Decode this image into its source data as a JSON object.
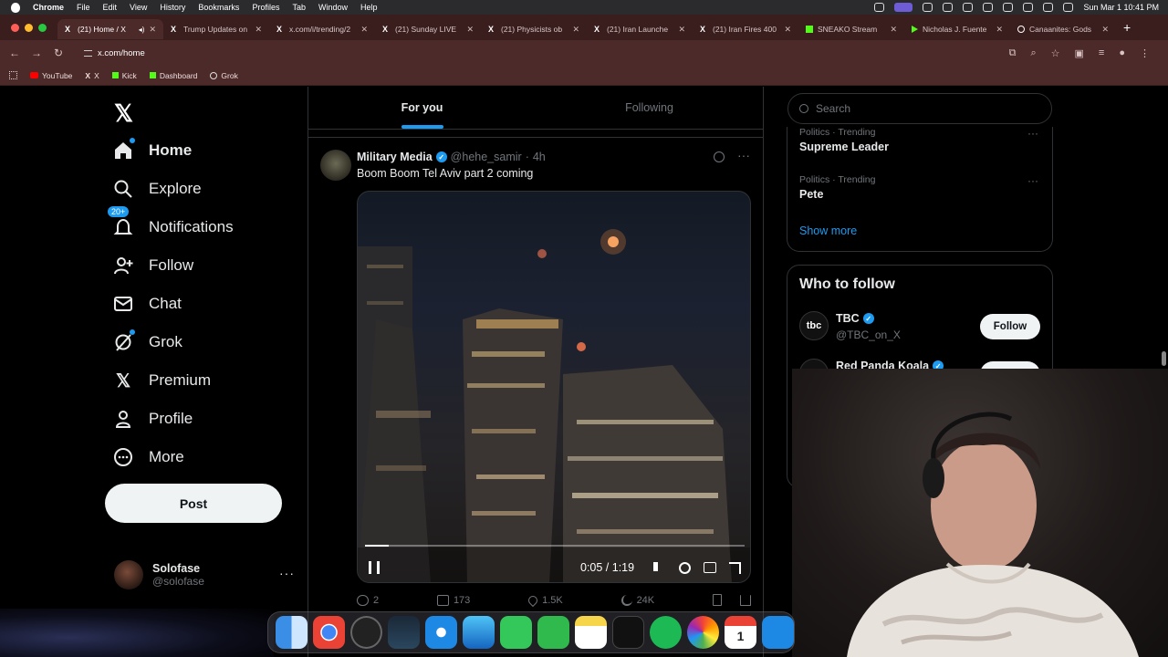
{
  "menubar": {
    "app": "Chrome",
    "items": [
      "File",
      "Edit",
      "View",
      "History",
      "Bookmarks",
      "Profiles",
      "Tab",
      "Window",
      "Help"
    ],
    "datetime": "Sun Mar 1  10:41 PM"
  },
  "tabs": [
    {
      "title": "(21) Home / X",
      "fav": "x"
    },
    {
      "title": "Trump Updates on",
      "fav": "x"
    },
    {
      "title": "x.com/i/trending/2",
      "fav": "x"
    },
    {
      "title": "(21) Sunday LIVE",
      "fav": "x"
    },
    {
      "title": "(21) Physicists ob",
      "fav": "x"
    },
    {
      "title": "(21) Iran Launche",
      "fav": "x"
    },
    {
      "title": "(21) Iran Fires 400",
      "fav": "x"
    },
    {
      "title": "SNEAKO Stream",
      "fav": "k"
    },
    {
      "title": "Nicholas J. Fuente",
      "fav": "p"
    },
    {
      "title": "Canaanites: Gods",
      "fav": "c"
    }
  ],
  "address": {
    "url": "x.com/home"
  },
  "bookmarks": [
    "YouTube",
    "X",
    "Kick",
    "Dashboard",
    "Grok"
  ],
  "nav": {
    "home": "Home",
    "explore": "Explore",
    "notifications": "Notifications",
    "notif_badge": "20+",
    "follow": "Follow",
    "chat": "Chat",
    "grok": "Grok",
    "premium": "Premium",
    "profile": "Profile",
    "more": "More",
    "post": "Post"
  },
  "account": {
    "name": "Solofase",
    "handle": "@solofase"
  },
  "feed": {
    "tab_for_you": "For you",
    "tab_following": "Following"
  },
  "tweet": {
    "name": "Military Media",
    "handle": "@hehe_samir",
    "time": "4h",
    "text": "Boom Boom Tel Aviv part 2 coming",
    "video_time": "0:05 / 1:19",
    "progress": 0.063,
    "replies": "2",
    "reposts": "173",
    "likes": "1.5K",
    "views": "24K"
  },
  "sidebar": {
    "search_placeholder": "Search",
    "trends": [
      {
        "category": "Politics · Trending",
        "name": "Supreme Leader"
      },
      {
        "category": "Politics · Trending",
        "name": "Pete"
      }
    ],
    "show_more": "Show more",
    "who_to_follow": "Who to follow",
    "suggestions": [
      {
        "name": "TBC",
        "handle": "@TBC_on_X",
        "avatar_text": "tbc",
        "button": "Follow"
      },
      {
        "name": "Red Panda Koala",
        "handle": "",
        "avatar_text": "",
        "button": "Follow"
      }
    ]
  },
  "colors": {
    "accent": "#1d9bf0",
    "tab_bar": "#3a1d1d",
    "toolbar": "#4d2a2a"
  }
}
